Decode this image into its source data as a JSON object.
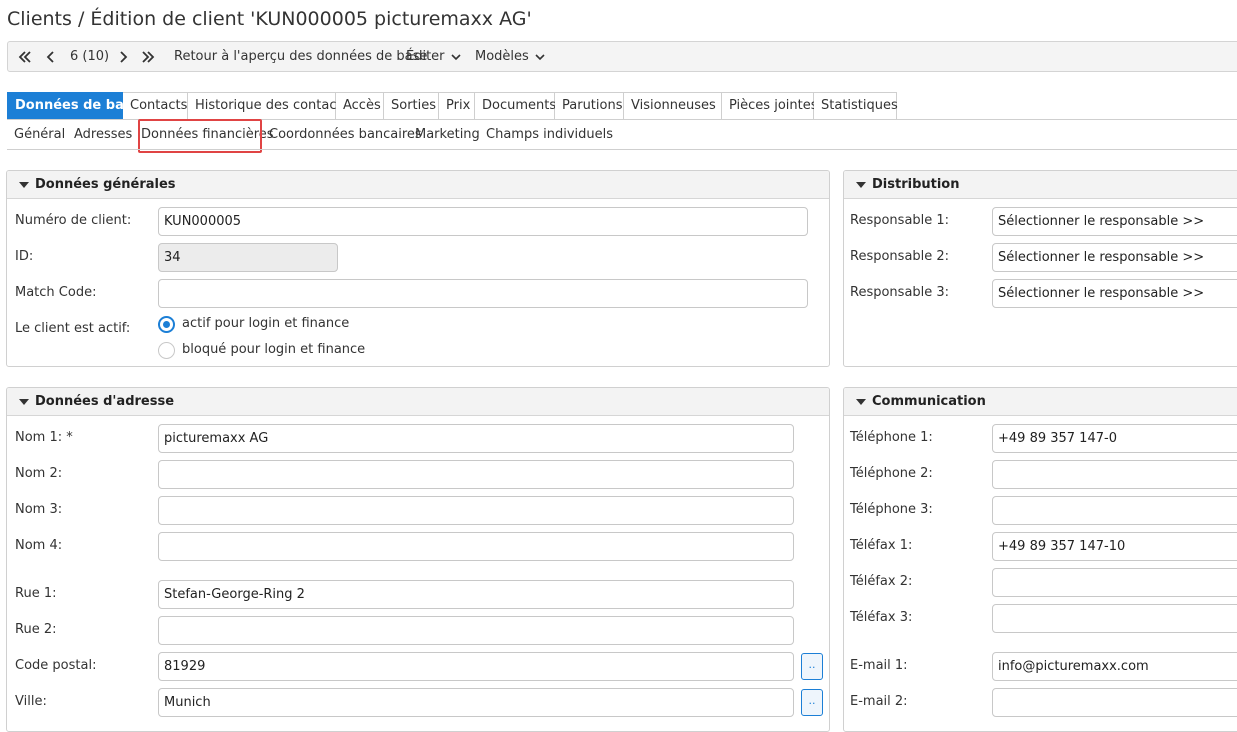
{
  "page": {
    "title": "Clients / Édition de client 'KUN000005 picturemaxx AG'"
  },
  "toolbar": {
    "first_icon": "double-chevron-left-icon",
    "prev_icon": "chevron-left-icon",
    "record_position": "6 (10)",
    "next_icon": "chevron-right-icon",
    "last_icon": "double-chevron-right-icon",
    "back_link": "Retour à l'aperçu des données de base",
    "edit_menu": "Éditer",
    "templates_menu": "Modèles"
  },
  "tabs": [
    "Données de base",
    "Contacts",
    "Historique des contacts",
    "Accès",
    "Sorties",
    "Prix",
    "Documents",
    "Parutions",
    "Visionneuses",
    "Pièces jointes",
    "Statistiques"
  ],
  "active_tab": "Données de base",
  "subtabs": [
    "Général",
    "Adresses",
    "Données financières",
    "Coordonnées bancaires",
    "Marketing",
    "Champs individuels"
  ],
  "highlighted_subtab": "Données financières",
  "colors": {
    "accent": "#1c7fd6",
    "highlight_box": "#e04444"
  },
  "general": {
    "title": "Données générales",
    "customer_number_label": "Numéro de client:",
    "customer_number_value": "KUN000005",
    "id_label": "ID:",
    "id_value": "34",
    "match_code_label": "Match Code:",
    "match_code_value": "",
    "active_label": "Le client est actif:",
    "active_option": "actif pour login et finance",
    "blocked_option": "bloqué pour login et finance",
    "selected_status": "actif pour login et finance"
  },
  "distribution": {
    "title": "Distribution",
    "responsible_1_label": "Responsable 1:",
    "responsible_2_label": "Responsable 2:",
    "responsible_3_label": "Responsable 3:",
    "select_placeholder": "Sélectionner le responsable >>"
  },
  "address": {
    "title": "Données d'adresse",
    "name1_label": "Nom 1: *",
    "name1_value": "picturemaxx AG",
    "name2_label": "Nom 2:",
    "name2_value": "",
    "name3_label": "Nom 3:",
    "name3_value": "",
    "name4_label": "Nom 4:",
    "name4_value": "",
    "street1_label": "Rue 1:",
    "street1_value": "Stefan-George-Ring 2",
    "street2_label": "Rue 2:",
    "street2_value": "",
    "postal_label": "Code postal:",
    "postal_value": "81929",
    "city_label": "Ville:",
    "city_value": "Munich",
    "lookup_label": ".."
  },
  "communication": {
    "title": "Communication",
    "phone1_label": "Téléphone 1:",
    "phone1_value": "+49 89 357 147-0",
    "phone2_label": "Téléphone 2:",
    "phone2_value": "",
    "phone3_label": "Téléphone 3:",
    "phone3_value": "",
    "fax1_label": "Téléfax 1:",
    "fax1_value": "+49 89 357 147-10",
    "fax2_label": "Téléfax 2:",
    "fax2_value": "",
    "fax3_label": "Téléfax 3:",
    "fax3_value": "",
    "email1_label": "E-mail 1:",
    "email1_value": "info@picturemaxx.com",
    "email2_label": "E-mail 2:",
    "email2_value": ""
  }
}
